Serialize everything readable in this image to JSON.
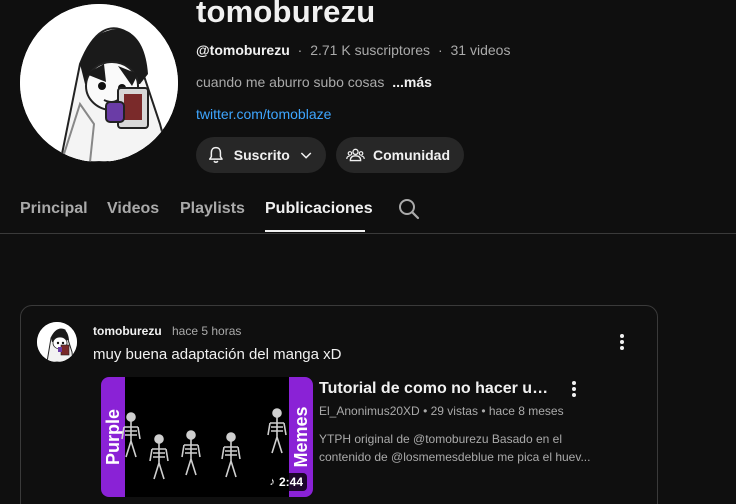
{
  "channel": {
    "name": "tomoburezu",
    "handle": "@tomoburezu",
    "subscribers": "2.71 K suscriptores",
    "video_count": "31 videos",
    "description": "cuando me aburro subo cosas",
    "more_label": "...más",
    "link": "twitter.com/tomoblaze",
    "subscribe_label": "Suscrito",
    "community_label": "Comunidad"
  },
  "tabs": [
    {
      "label": "Principal"
    },
    {
      "label": "Videos"
    },
    {
      "label": "Playlists"
    },
    {
      "label": "Publicaciones"
    }
  ],
  "post": {
    "author": "tomoburezu",
    "time": "hace 5 horas",
    "text": "muy buena adaptación del manga xD",
    "video": {
      "title": "Tutorial de como no hacer un...",
      "channel": "El_Anonimus20XD",
      "views": "29 vistas",
      "age": "hace 8 meses",
      "desc_line1": "YTPH original de @tomoburezu Basado en el",
      "desc_line2": "contenido de @losmemesdeblue me pica el huev...",
      "duration": "2:44",
      "thumb_text_left": "Purple",
      "thumb_text_right": "Memes"
    }
  },
  "colors": {
    "background": "#0f0f0f",
    "link": "#3ea6ff",
    "button_bg": "#272727",
    "thumb_purple": "#8a22d6"
  },
  "icons": [
    "bell-icon",
    "chevron-down-icon",
    "people-icon",
    "search-icon",
    "more-vert-icon",
    "music-note-icon"
  ]
}
